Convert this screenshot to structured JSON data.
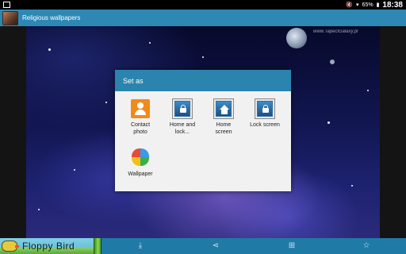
{
  "status_bar": {
    "battery": "65%",
    "time": "18:38"
  },
  "action_bar": {
    "title": "Religious wallpapers"
  },
  "wallpaper": {
    "watermark": "www.TapeciGalaxy.pl"
  },
  "dialog": {
    "title": "Set as",
    "options": [
      {
        "label_1": "Contact",
        "label_2": "photo",
        "icon": "contact-icon"
      },
      {
        "label_1": "Home and",
        "label_2": "lock...",
        "icon": "lock-frame-icon"
      },
      {
        "label_1": "Home",
        "label_2": "screen",
        "icon": "home-frame-icon"
      },
      {
        "label_1": "Lock screen",
        "label_2": "",
        "icon": "lock-frame-icon"
      },
      {
        "label_1": "Wallpaper",
        "label_2": "",
        "icon": "pinwheel-icon"
      }
    ]
  },
  "bottom_bar": {
    "ad_text": "Floppy Bird",
    "icons": [
      "download-icon",
      "share-icon",
      "crop-icon",
      "star-icon"
    ]
  },
  "colors": {
    "accent": "#2d88b4",
    "dialog_header": "#2b84ae",
    "bottom_bar": "#1f7aa6"
  }
}
